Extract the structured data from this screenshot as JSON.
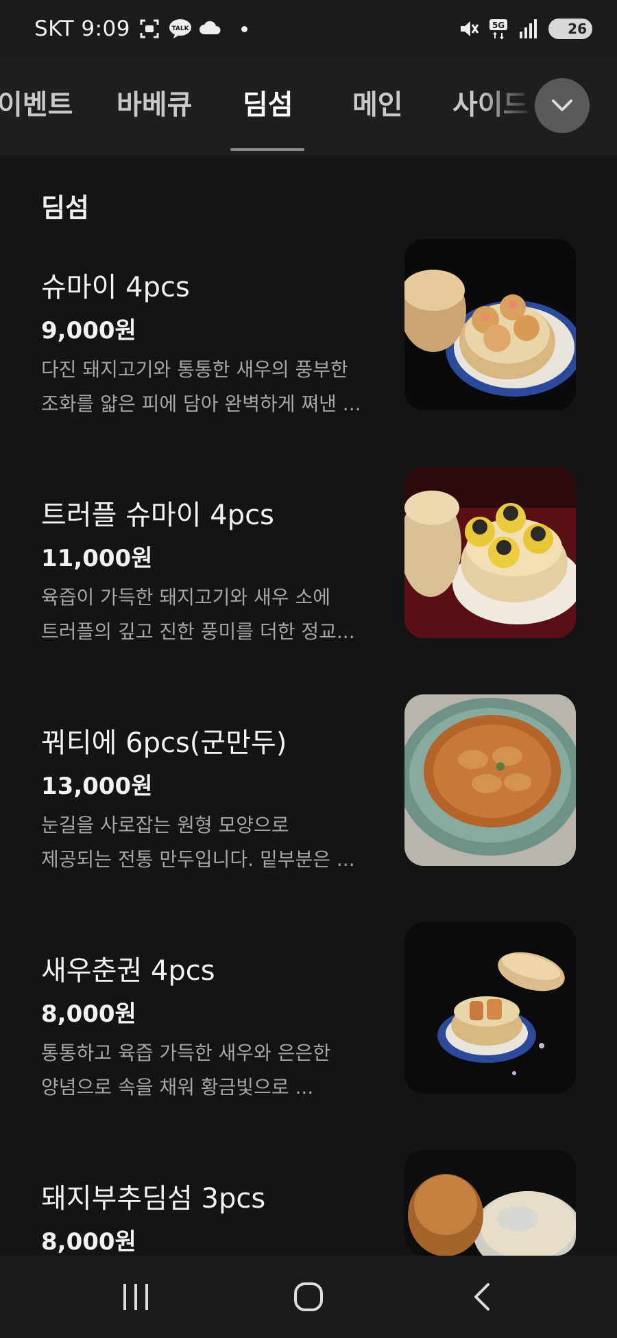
{
  "status_bar": {
    "carrier_time": "SKT 9:09",
    "battery": "26",
    "icons": [
      "screenshot-icon",
      "kakaotalk-icon",
      "cloud-icon",
      "dot-icon",
      "mute-icon",
      "5g-icon",
      "signal-icon",
      "battery-icon"
    ]
  },
  "tabs": [
    {
      "label": "이벤트"
    },
    {
      "label": "바베큐"
    },
    {
      "label": "딤섬"
    },
    {
      "label": "메인"
    },
    {
      "label": "사이드"
    }
  ],
  "active_tab": "딤섬",
  "section": {
    "title": "딤섬"
  },
  "items": [
    {
      "name": "슈마이 4pcs",
      "price": "9,000원",
      "desc1": "다진 돼지고기와 통통한 새우의 풍부한",
      "desc2": "조화를 얇은 피에 담아 완벽하게 쪄낸 ..."
    },
    {
      "name": "트러플 슈마이 4pcs",
      "price": "11,000원",
      "desc1": "육즙이 가득한 돼지고기와 새우 소에",
      "desc2": "트러플의 깊고 진한 풍미를 더한 정교..."
    },
    {
      "name": "꿔티에 6pcs(군만두)",
      "price": "13,000원",
      "desc1": "눈길을 사로잡는 원형 모양으로",
      "desc2": "제공되는 전통 만두입니다. 밑부분은 ..."
    },
    {
      "name": "새우춘권 4pcs",
      "price": "8,000원",
      "desc1": "통통하고 육즙 가득한 새우와 은은한",
      "desc2": "양념으로 속을 채워 황금빛으로 ..."
    },
    {
      "name": "돼지부추딤섬 3pcs",
      "price": "8,000원",
      "desc1": "",
      "desc2": ""
    }
  ],
  "nav": [
    "recent-apps",
    "home",
    "back"
  ]
}
